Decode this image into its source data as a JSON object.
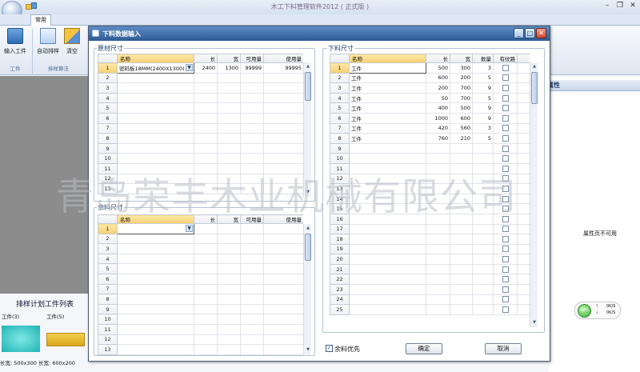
{
  "app": {
    "title": "木工下料管理软件2012 ( 正式版 )",
    "tab_common": "常用"
  },
  "ribbon": {
    "input_parts": "输入工件",
    "auto_nesting": "自动排样",
    "clear": "清空",
    "group_parts": "工件",
    "group_nesting": "排样算法"
  },
  "left_panel": {
    "list_title": "排样计划工件列表",
    "piece1_caption": "工件(3)",
    "piece2_caption": "工件(5)",
    "status_text": "长宽: 500x300  长宽: 600x200"
  },
  "right_panel": {
    "header": "属性",
    "property_unavailable": "属性页不可用",
    "gauge_percent": "62%",
    "upload": "0K/S",
    "download": "0K/S"
  },
  "dialog": {
    "title": "下料数据输入",
    "raw_section": {
      "legend": "原材尺寸",
      "headers": [
        "名称",
        "长",
        "宽",
        "可用量",
        "使用量"
      ],
      "rows": [
        {
          "num": "1",
          "name": "密码板18MM(2400X1300)",
          "len": "2400",
          "wid": "1300",
          "avail": "99999",
          "used": "99995"
        },
        {
          "num": "2",
          "name": "",
          "len": "",
          "wid": "",
          "avail": "",
          "used": ""
        },
        {
          "num": "3",
          "name": "",
          "len": "",
          "wid": "",
          "avail": "",
          "used": ""
        },
        {
          "num": "4",
          "name": "",
          "len": "",
          "wid": "",
          "avail": "",
          "used": ""
        },
        {
          "num": "5",
          "name": "",
          "len": "",
          "wid": "",
          "avail": "",
          "used": ""
        },
        {
          "num": "6",
          "name": "",
          "len": "",
          "wid": "",
          "avail": "",
          "used": ""
        },
        {
          "num": "7",
          "name": "",
          "len": "",
          "wid": "",
          "avail": "",
          "used": ""
        },
        {
          "num": "8",
          "name": "",
          "len": "",
          "wid": "",
          "avail": "",
          "used": ""
        },
        {
          "num": "9",
          "name": "",
          "len": "",
          "wid": "",
          "avail": "",
          "used": ""
        },
        {
          "num": "10",
          "name": "",
          "len": "",
          "wid": "",
          "avail": "",
          "used": ""
        },
        {
          "num": "11",
          "name": "",
          "len": "",
          "wid": "",
          "avail": "",
          "used": ""
        },
        {
          "num": "12",
          "name": "",
          "len": "",
          "wid": "",
          "avail": "",
          "used": ""
        },
        {
          "num": "13",
          "name": "",
          "len": "",
          "wid": "",
          "avail": "",
          "used": ""
        }
      ]
    },
    "remnant_section": {
      "legend": "余料尺寸",
      "headers": [
        "名称",
        "长",
        "宽",
        "可用量",
        "使用量"
      ],
      "rows": [
        {
          "num": "1",
          "name": "",
          "len": "",
          "wid": "",
          "avail": "",
          "used": ""
        },
        {
          "num": "2",
          "name": "",
          "len": "",
          "wid": "",
          "avail": "",
          "used": ""
        },
        {
          "num": "3",
          "name": "",
          "len": "",
          "wid": "",
          "avail": "",
          "used": ""
        },
        {
          "num": "4",
          "name": "",
          "len": "",
          "wid": "",
          "avail": "",
          "used": ""
        },
        {
          "num": "5",
          "name": "",
          "len": "",
          "wid": "",
          "avail": "",
          "used": ""
        },
        {
          "num": "6",
          "name": "",
          "len": "",
          "wid": "",
          "avail": "",
          "used": ""
        },
        {
          "num": "7",
          "name": "",
          "len": "",
          "wid": "",
          "avail": "",
          "used": ""
        },
        {
          "num": "8",
          "name": "",
          "len": "",
          "wid": "",
          "avail": "",
          "used": ""
        },
        {
          "num": "9",
          "name": "",
          "len": "",
          "wid": "",
          "avail": "",
          "used": ""
        },
        {
          "num": "10",
          "name": "",
          "len": "",
          "wid": "",
          "avail": "",
          "used": ""
        },
        {
          "num": "11",
          "name": "",
          "len": "",
          "wid": "",
          "avail": "",
          "used": ""
        },
        {
          "num": "12",
          "name": "",
          "len": "",
          "wid": "",
          "avail": "",
          "used": ""
        },
        {
          "num": "13",
          "name": "",
          "len": "",
          "wid": "",
          "avail": "",
          "used": ""
        }
      ]
    },
    "parts_section": {
      "legend": "下料尺寸",
      "headers": [
        "名称",
        "长",
        "宽",
        "数量",
        "有纹路"
      ],
      "rows": [
        {
          "num": "1",
          "name": "工件",
          "len": "500",
          "wid": "300",
          "qty": "3"
        },
        {
          "num": "2",
          "name": "工件",
          "len": "600",
          "wid": "200",
          "qty": "5"
        },
        {
          "num": "3",
          "name": "工件",
          "len": "200",
          "wid": "700",
          "qty": "9"
        },
        {
          "num": "4",
          "name": "工件",
          "len": "50",
          "wid": "700",
          "qty": "5"
        },
        {
          "num": "5",
          "name": "工件",
          "len": "400",
          "wid": "500",
          "qty": "9"
        },
        {
          "num": "6",
          "name": "工件",
          "len": "1000",
          "wid": "600",
          "qty": "9"
        },
        {
          "num": "7",
          "name": "工件",
          "len": "420",
          "wid": "560",
          "qty": "3"
        },
        {
          "num": "8",
          "name": "工件",
          "len": "760",
          "wid": "210",
          "qty": "5"
        },
        {
          "num": "9",
          "name": "",
          "len": "",
          "wid": "",
          "qty": ""
        },
        {
          "num": "10",
          "name": "",
          "len": "",
          "wid": "",
          "qty": ""
        },
        {
          "num": "11",
          "name": "",
          "len": "",
          "wid": "",
          "qty": ""
        },
        {
          "num": "12",
          "name": "",
          "len": "",
          "wid": "",
          "qty": ""
        },
        {
          "num": "13",
          "name": "",
          "len": "",
          "wid": "",
          "qty": ""
        },
        {
          "num": "14",
          "name": "",
          "len": "",
          "wid": "",
          "qty": ""
        },
        {
          "num": "15",
          "name": "",
          "len": "",
          "wid": "",
          "qty": ""
        },
        {
          "num": "16",
          "name": "",
          "len": "",
          "wid": "",
          "qty": ""
        },
        {
          "num": "17",
          "name": "",
          "len": "",
          "wid": "",
          "qty": ""
        },
        {
          "num": "18",
          "name": "",
          "len": "",
          "wid": "",
          "qty": ""
        },
        {
          "num": "19",
          "name": "",
          "len": "",
          "wid": "",
          "qty": ""
        },
        {
          "num": "20",
          "name": "",
          "len": "",
          "wid": "",
          "qty": ""
        },
        {
          "num": "21",
          "name": "",
          "len": "",
          "wid": "",
          "qty": ""
        },
        {
          "num": "22",
          "name": "",
          "len": "",
          "wid": "",
          "qty": ""
        },
        {
          "num": "23",
          "name": "",
          "len": "",
          "wid": "",
          "qty": ""
        },
        {
          "num": "24",
          "name": "",
          "len": "",
          "wid": "",
          "qty": ""
        },
        {
          "num": "25",
          "name": "",
          "len": "",
          "wid": "",
          "qty": ""
        }
      ]
    },
    "remnant_first_label": "余料优先",
    "ok_button": "确定",
    "cancel_button": "取消"
  },
  "watermark": "青岛荣丰木业机械有限公司"
}
